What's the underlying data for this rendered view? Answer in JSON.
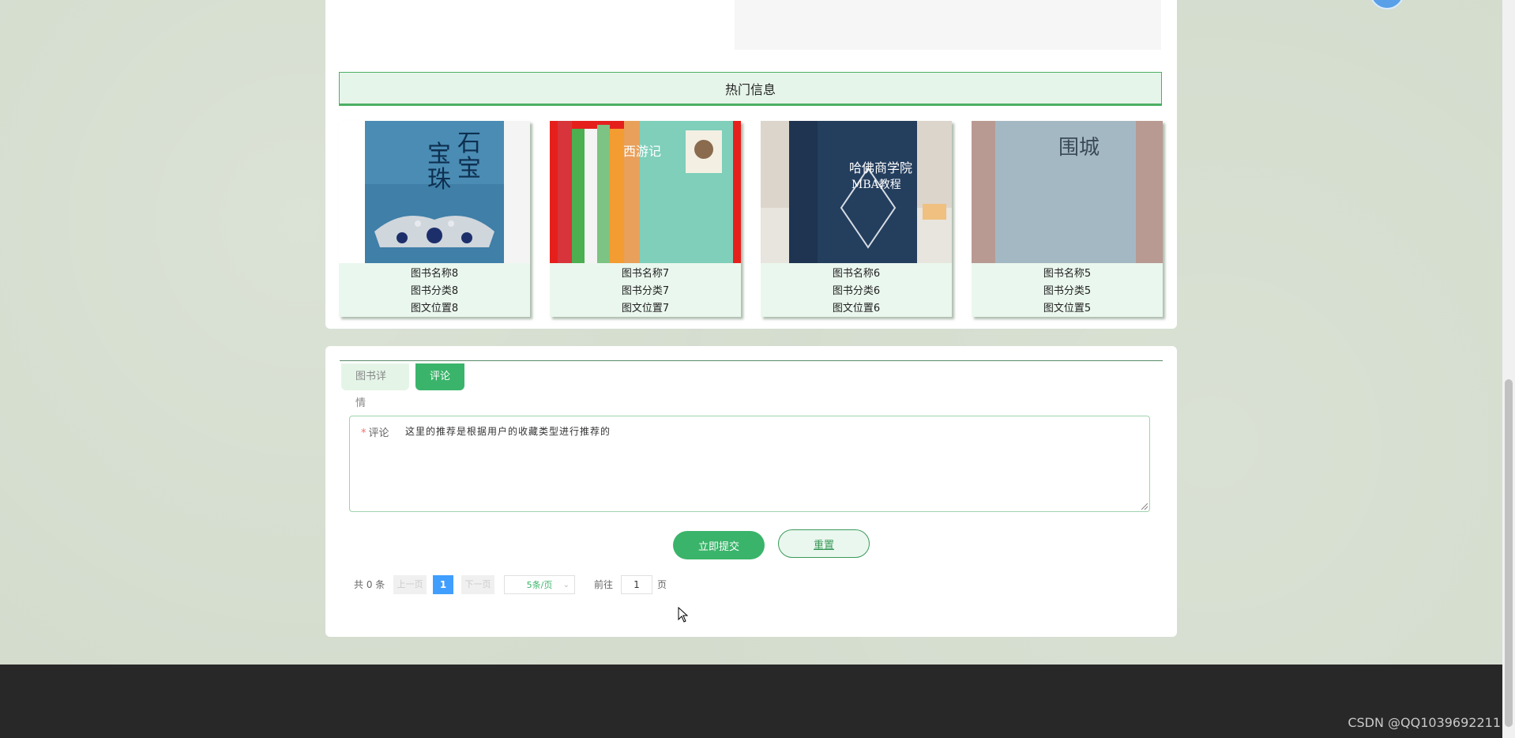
{
  "hot_section": {
    "title": "热门信息",
    "books": [
      {
        "name": "图书名称8",
        "category": "图书分类8",
        "location": "图文位置8"
      },
      {
        "name": "图书名称7",
        "category": "图书分类7",
        "location": "图文位置7"
      },
      {
        "name": "图书名称6",
        "category": "图书分类6",
        "location": "图文位置6"
      },
      {
        "name": "图书名称5",
        "category": "图书分类5",
        "location": "图文位置5"
      }
    ],
    "cover_texts": {
      "book8": "宝石珠宝",
      "book7": "西游记",
      "book6": "哈佛商学院 MBA教程",
      "book5": "围城"
    }
  },
  "tabs": {
    "details": "图书详情",
    "comments": "评论"
  },
  "comment_form": {
    "label": "评论",
    "value": "这里的推荐是根据用户的收藏类型进行推荐的",
    "submit": "立即提交",
    "reset": "重置"
  },
  "pagination": {
    "total": "共 0 条",
    "prev": "上一页",
    "current": "1",
    "next": "下一页",
    "page_size": "5条/页",
    "goto": "前往",
    "goto_value": "1",
    "page_unit": "页"
  },
  "watermark": "CSDN @QQ1039692211",
  "colors": {
    "accent": "#3ab46a",
    "active_page": "#409eff",
    "footer": "#282828"
  }
}
